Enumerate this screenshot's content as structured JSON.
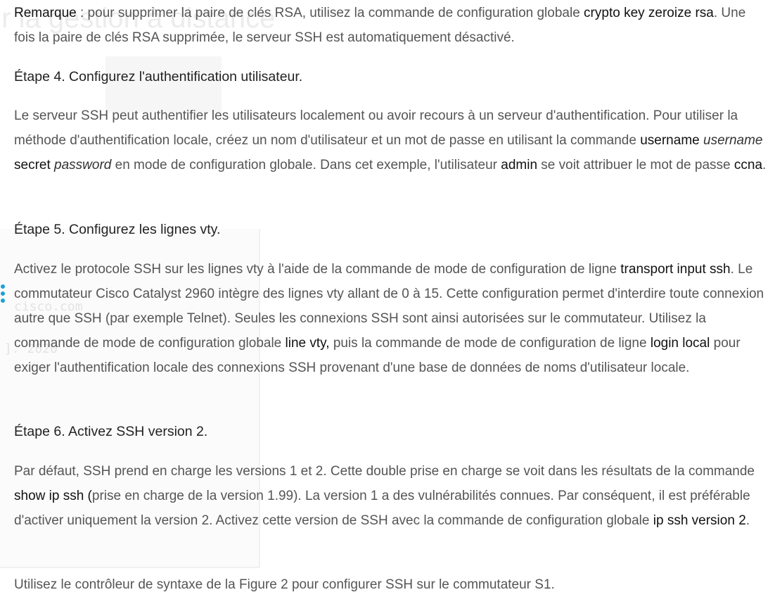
{
  "background": {
    "ghost_title": "ur la gestion à distance",
    "ghost_text_1": "cisco.com",
    "ghost_text_2": "]. 2020"
  },
  "note": {
    "label": "Remarque",
    "t1": " : pour supprimer la paire de clés RSA, utilisez la commande de configuration globale ",
    "cmd": "crypto key zeroize rsa",
    "t2": ". Une fois la paire de clés RSA supprimée, le serveur SSH est automatiquement désactivé."
  },
  "step4": {
    "heading": "Étape 4. Configurez l'authentification utilisateur.",
    "t1": "Le serveur SSH peut authentifier les utilisateurs localement ou avoir recours à un serveur d'authentification. Pour utiliser la méthode d'authentification locale, créez un nom d'utilisateur et un mot de passe en utilisant la commande ",
    "cmd1": "username",
    "arg1": "username",
    "cmd2": "secret",
    "arg2": "password",
    "t2": " en mode de configuration globale. Dans cet exemple, l'utilisateur ",
    "user": "admin",
    "t3": " se voit attribuer le mot de passe ",
    "pass": "ccna",
    "t4": "."
  },
  "step5": {
    "heading": "Étape 5. Configurez les lignes vty.",
    "t1": "Activez le protocole SSH sur les lignes vty à l'aide de la commande de mode de configuration de ligne ",
    "cmd1": "transport input ssh",
    "t2": ". Le commutateur Cisco Catalyst 2960 intègre des lignes vty allant de 0 à 15. Cette configuration permet d'interdire toute connexion autre que SSH (par exemple Telnet). Seules les connexions SSH sont ainsi autorisées sur le commutateur. Utilisez la commande de mode de configuration globale ",
    "cmd2": "line vty,",
    "t3": " puis la commande de mode de configuration de ligne ",
    "cmd3": "login local",
    "t4": " pour exiger l'authentification locale des connexions SSH provenant d'une base de données de noms d'utilisateur locale."
  },
  "step6": {
    "heading": "Étape 6. Activez SSH version 2.",
    "t1": "Par défaut, SSH prend en charge les versions 1 et 2. Cette double prise en charge se voit dans les résultats de la commande ",
    "cmd1": "show ip ssh (",
    "t2": "prise en charge de la version 1.99). La version 1 a des vulnérabilités connues. Par conséquent, il est préférable d'activer uniquement la version 2. Activez cette version de SSH avec la commande de configuration globale ",
    "cmd2": "ip ssh version 2",
    "t3": "."
  },
  "final": {
    "text": "Utilisez le contrôleur de syntaxe de la Figure 2 pour configurer SSH sur le commutateur S1."
  },
  "colors": {
    "body_text": "#555555",
    "emphasis": "#111111",
    "heading": "#222222",
    "accent_dots": "#1ba0d7"
  }
}
